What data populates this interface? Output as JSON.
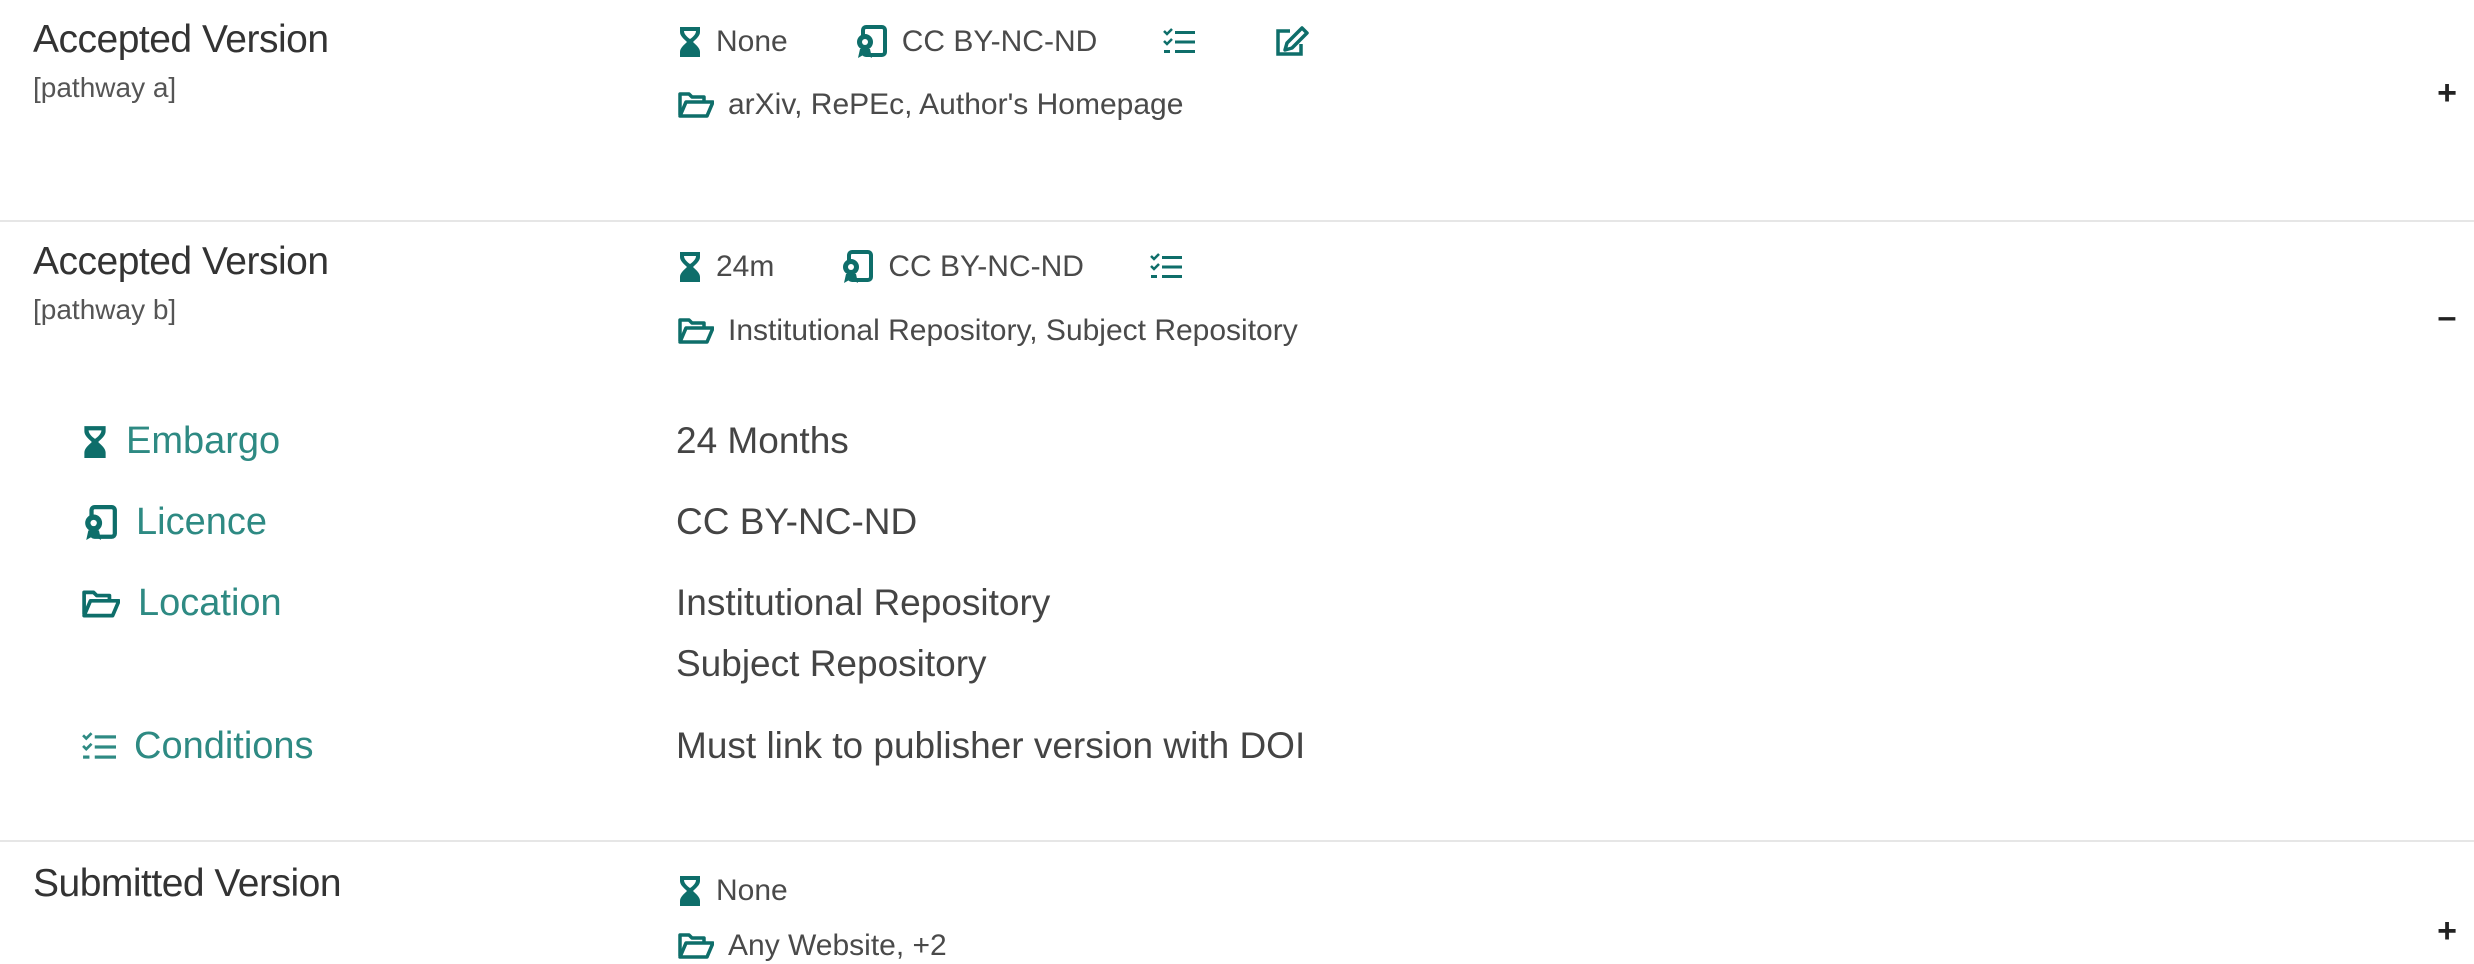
{
  "colors": {
    "accent": "#0e6e6a",
    "label_teal": "#2e8a83",
    "text": "#444444",
    "divider": "#e6e6e6"
  },
  "pathways": [
    {
      "title": "Accepted Version",
      "subtitle": "[pathway a]",
      "embargo_short": "None",
      "licence_short": "CC BY-NC-ND",
      "locations_short": "arXiv, RePEc, Author's Homepage",
      "icons": [
        "hourglass-icon",
        "licence-icon",
        "conditions-list-icon",
        "edit-icon",
        "folder-icon"
      ],
      "toggle": "+",
      "expanded": false
    },
    {
      "title": "Accepted Version",
      "subtitle": "[pathway b]",
      "embargo_short": "24m",
      "licence_short": "CC BY-NC-ND",
      "locations_short": "Institutional Repository, Subject Repository",
      "icons": [
        "hourglass-icon",
        "licence-icon",
        "conditions-list-icon",
        "folder-icon"
      ],
      "toggle": "–",
      "expanded": true,
      "details": {
        "embargo_label": "Embargo",
        "embargo_value": "24 Months",
        "licence_label": "Licence",
        "licence_value": "CC BY-NC-ND",
        "location_label": "Location",
        "location_values": [
          "Institutional Repository",
          "Subject Repository"
        ],
        "conditions_label": "Conditions",
        "conditions_value": "Must link to publisher version with DOI"
      }
    },
    {
      "title": "Submitted Version",
      "embargo_short": "None",
      "locations_short": "Any Website, +2",
      "icons": [
        "hourglass-icon",
        "folder-icon"
      ],
      "toggle": "+",
      "expanded": false
    }
  ]
}
